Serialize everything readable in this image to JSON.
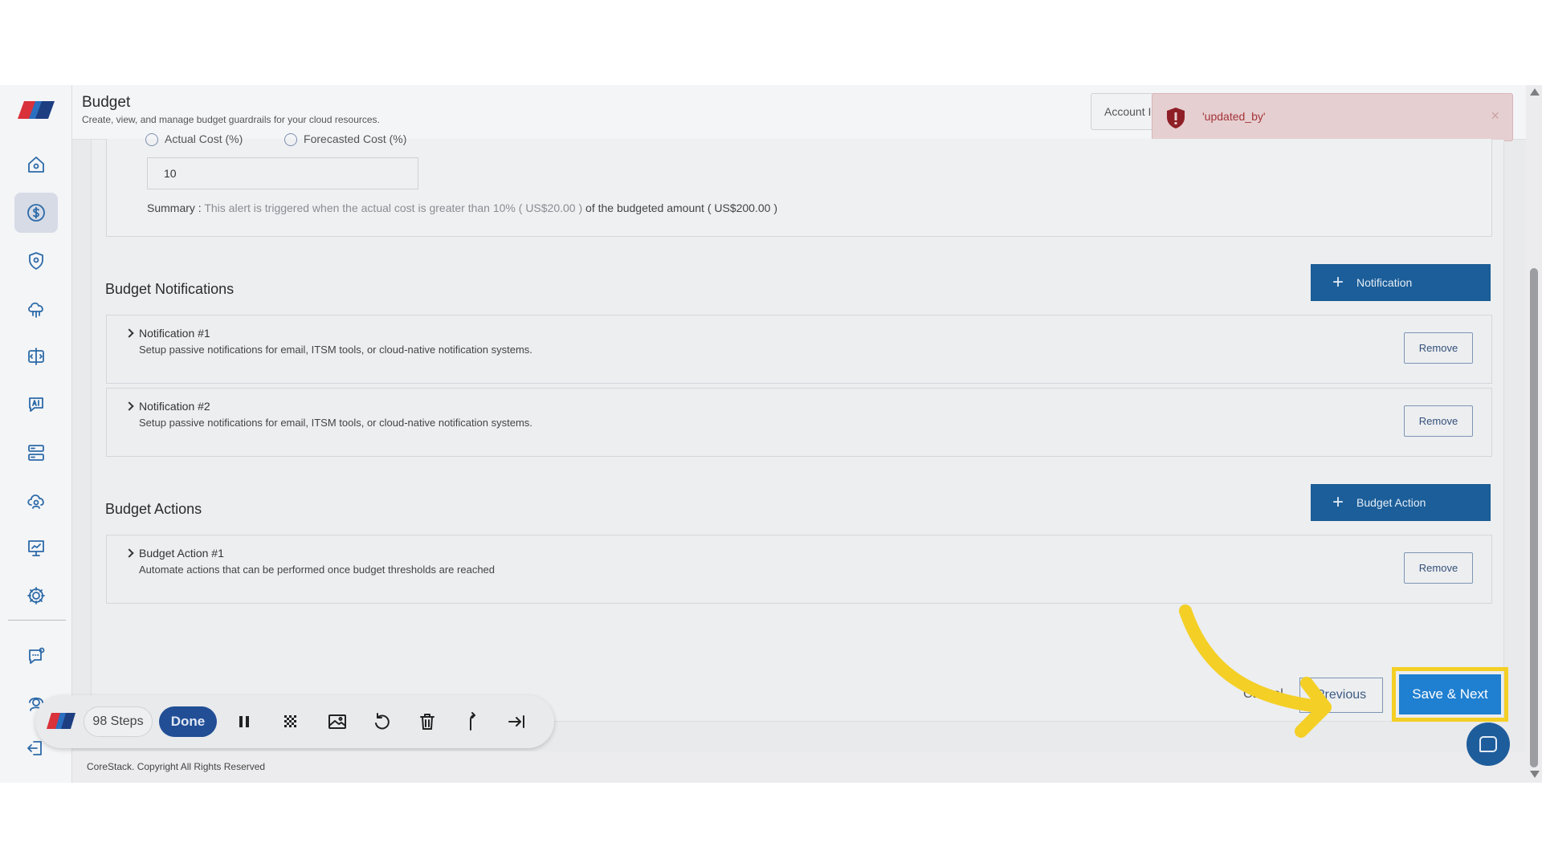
{
  "header": {
    "title": "Budget",
    "subtitle": "Create, view, and manage budget guardrails for your cloud resources.",
    "account_label": "Account I"
  },
  "toast": {
    "message": "'updated_by'",
    "close": "×"
  },
  "alert": {
    "radio_actual": "Actual Cost (%)",
    "radio_forecasted": "Forecasted Cost (%)",
    "threshold_value": "10",
    "summary_label": "Summary :",
    "summary_text": "This alert is triggered when the actual cost is greater than 10%",
    "summary_amount1": "( US$20.00 )",
    "summary_mid": "of the budgeted amount",
    "summary_amount2": "( US$200.00 )"
  },
  "notifications": {
    "title": "Budget Notifications",
    "add_label": "Notification",
    "items": [
      {
        "title": "Notification #1",
        "desc": "Setup passive notifications for email, ITSM tools, or cloud-native notification systems.",
        "remove": "Remove"
      },
      {
        "title": "Notification #2",
        "desc": "Setup passive notifications for email, ITSM tools, or cloud-native notification systems.",
        "remove": "Remove"
      }
    ]
  },
  "actions": {
    "title": "Budget Actions",
    "add_label": "Budget Action",
    "items": [
      {
        "title": "Budget Action #1",
        "desc": "Automate actions that can be performed once budget thresholds are reached",
        "remove": "Remove"
      }
    ]
  },
  "footer_actions": {
    "cancel": "Cancel",
    "previous": "Previous",
    "save_next": "Save & Next"
  },
  "recorder": {
    "steps": "98 Steps",
    "done": "Done"
  },
  "footer": {
    "copyright": "CoreStack. Copyright All Rights Reserved"
  },
  "colors": {
    "accent": "#1f7fd0",
    "primary_dark": "#1b5e99",
    "highlight": "#f4cf25",
    "error": "#a3343a"
  },
  "icons": {
    "sidebar": [
      "home-icon",
      "dollar-icon",
      "shield-icon",
      "cloud-network-icon",
      "compare-icon",
      "ai-chat-icon",
      "server-icon",
      "cloud-user-icon",
      "presentation-icon",
      "settings-icon",
      "chat-alert-icon",
      "user-support-icon",
      "logout-icon"
    ],
    "recorder": [
      "pause-icon",
      "blur-icon",
      "image-icon",
      "undo-icon",
      "trash-icon",
      "branch-icon",
      "skip-end-icon"
    ]
  }
}
